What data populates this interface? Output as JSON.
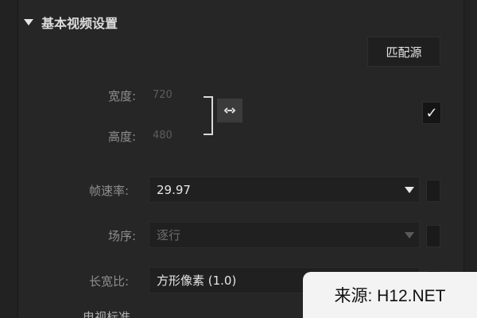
{
  "section": {
    "title": "基本视频设置",
    "match_button": "匹配源"
  },
  "fields": {
    "width": {
      "label": "宽度:",
      "value": "720"
    },
    "height": {
      "label": "高度:",
      "value": "480"
    },
    "frame_rate": {
      "label": "帧速率:",
      "value": "29.97"
    },
    "field_order": {
      "label": "场序:",
      "value": "逐行"
    },
    "aspect": {
      "label": "长宽比:",
      "value": "方形像素 (1.0)"
    }
  },
  "bottom": {
    "label": "电视标准"
  },
  "watermark": {
    "text": "来源: H12.NET"
  },
  "colors": {
    "background": "#262626",
    "text": "#dcdcdc",
    "dim": "#8e8e8e"
  }
}
